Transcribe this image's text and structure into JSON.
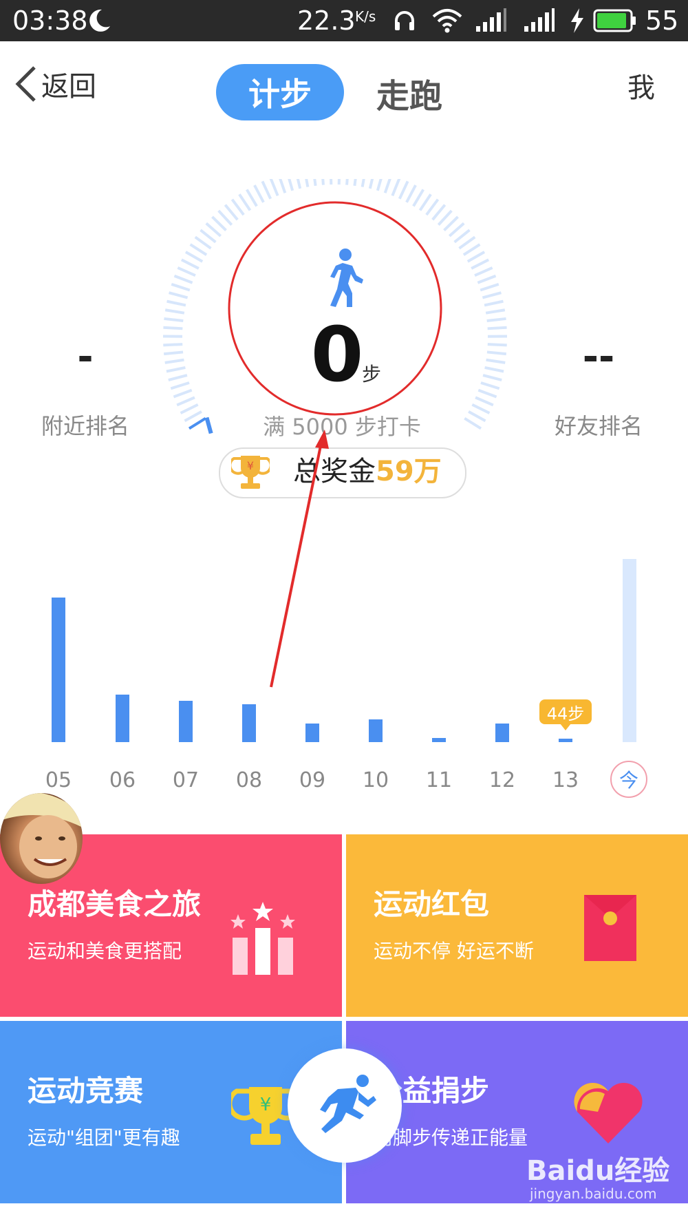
{
  "status_bar": {
    "time": "03:38",
    "speed": "22.3",
    "speed_unit": "K/s",
    "battery": "55"
  },
  "nav": {
    "back_label": "返回",
    "tabs": [
      {
        "label": "计步",
        "active": true
      },
      {
        "label": "走跑",
        "active": false
      }
    ],
    "me_label": "我"
  },
  "gauge": {
    "nearby_rank_value": "-",
    "nearby_rank_label": "附近排名",
    "friend_rank_value": "--",
    "friend_rank_label": "好友排名",
    "steps": "0",
    "steps_unit": "步",
    "goal_text": "满 5000 步打卡",
    "progress_fraction": 0.0
  },
  "prize": {
    "label": "总奖金",
    "amount": "59万"
  },
  "history": {
    "days": [
      {
        "label": "05"
      },
      {
        "label": "06"
      },
      {
        "label": "07"
      },
      {
        "label": "08"
      },
      {
        "label": "09"
      },
      {
        "label": "10"
      },
      {
        "label": "11"
      },
      {
        "label": "12"
      },
      {
        "label": "13"
      }
    ],
    "tooltip": "44步",
    "today_label": "今"
  },
  "cards": [
    {
      "title": "成都美食之旅",
      "subtitle": "运动和美食更搭配",
      "color": "#fb4d6f"
    },
    {
      "title": "运动红包",
      "subtitle": "运动不停 好运不断",
      "color": "#fbb93a"
    },
    {
      "title": "运动竞赛",
      "subtitle": "运动\"组团\"更有趣",
      "color": "#4f99f5"
    },
    {
      "title": "公益捐步",
      "subtitle": "用脚步传递正能量",
      "color": "#7c6af5"
    }
  ],
  "watermark": {
    "brand": "Baidu经验",
    "url": "jingyan.baidu.com"
  },
  "colors": {
    "accent": "#4a9cf6",
    "gold": "#f3b43b",
    "annotation_red": "#e22b2b"
  }
}
